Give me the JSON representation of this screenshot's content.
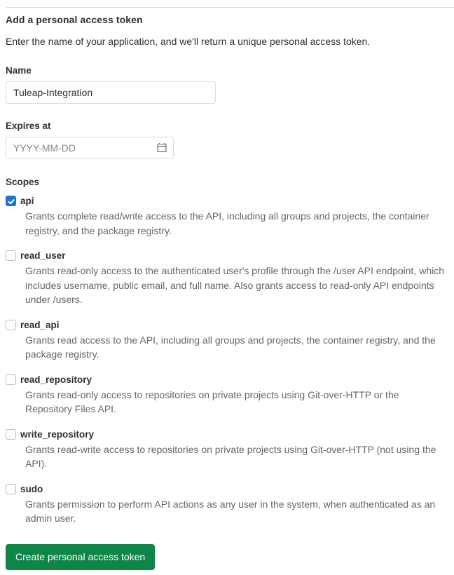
{
  "form": {
    "title": "Add a personal access token",
    "description": "Enter the name of your application, and we'll return a unique personal access token.",
    "name_label": "Name",
    "name_value": "Tuleap-Integration",
    "expires_label": "Expires at",
    "expires_value": "",
    "expires_placeholder": "YYYY-MM-DD",
    "calendar_icon": "calendar-icon",
    "scopes_label": "Scopes",
    "submit_label": "Create personal access token"
  },
  "colors": {
    "checkbox_checked": "#1f75cb",
    "submit_background": "#108548",
    "text_primary": "#303030",
    "text_muted": "#666666",
    "border": "#dbdbdb"
  },
  "scopes": [
    {
      "name": "api",
      "checked": true,
      "description": "Grants complete read/write access to the API, including all groups and projects, the container registry, and the package registry."
    },
    {
      "name": "read_user",
      "checked": false,
      "description": "Grants read-only access to the authenticated user's profile through the /user API endpoint, which includes username, public email, and full name. Also grants access to read-only API endpoints under /users."
    },
    {
      "name": "read_api",
      "checked": false,
      "description": "Grants read access to the API, including all groups and projects, the container registry, and the package registry."
    },
    {
      "name": "read_repository",
      "checked": false,
      "description": "Grants read-only access to repositories on private projects using Git-over-HTTP or the Repository Files API."
    },
    {
      "name": "write_repository",
      "checked": false,
      "description": "Grants read-write access to repositories on private projects using Git-over-HTTP (not using the API)."
    },
    {
      "name": "sudo",
      "checked": false,
      "description": "Grants permission to perform API actions as any user in the system, when authenticated as an admin user."
    }
  ]
}
